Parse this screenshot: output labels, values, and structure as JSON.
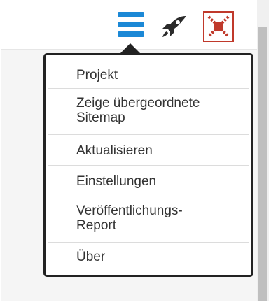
{
  "toolbar": {
    "icons": [
      "menu-icon",
      "rocket-icon",
      "sitemap-icon"
    ],
    "accent": "#1b88d6"
  },
  "menu": {
    "items": [
      {
        "lines": [
          "Projekt"
        ]
      },
      {
        "lines": [
          "Zeige übergeordnete",
          "Sitemap"
        ]
      },
      {
        "lines": [
          "Aktualisieren"
        ]
      },
      {
        "lines": [
          "Einstellungen"
        ]
      },
      {
        "lines": [
          "Veröffentlichungs-",
          "Report"
        ]
      },
      {
        "lines": [
          "Über"
        ]
      }
    ]
  }
}
